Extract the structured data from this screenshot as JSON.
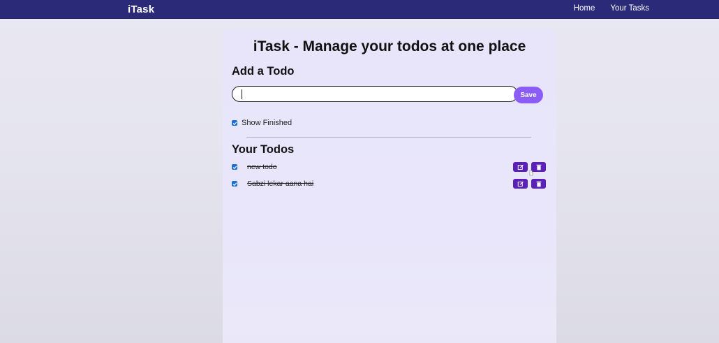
{
  "navbar": {
    "brand": "iTask",
    "links": [
      "Home",
      "Your Tasks"
    ]
  },
  "main": {
    "title": "iTask - Manage your todos at one place",
    "add_section": {
      "heading": "Add a Todo",
      "input_value": "",
      "input_placeholder": "",
      "save_label": "Save"
    },
    "show_finished": {
      "label": "Show Finished",
      "checked": true
    },
    "todos_section": {
      "heading": "Your Todos",
      "items": [
        {
          "text": "new todo",
          "completed": true
        },
        {
          "text": "Sabzi lekar aana hai",
          "completed": true
        }
      ]
    }
  },
  "colors": {
    "navbar_bg": "#2a2a78",
    "card_bg": "#e8e5fb",
    "save_button": "#8b5cf6",
    "action_button": "#5b21b6",
    "checkbox": "#1f6fd1"
  },
  "icons": {
    "edit": "edit-icon",
    "delete": "trash-icon"
  }
}
